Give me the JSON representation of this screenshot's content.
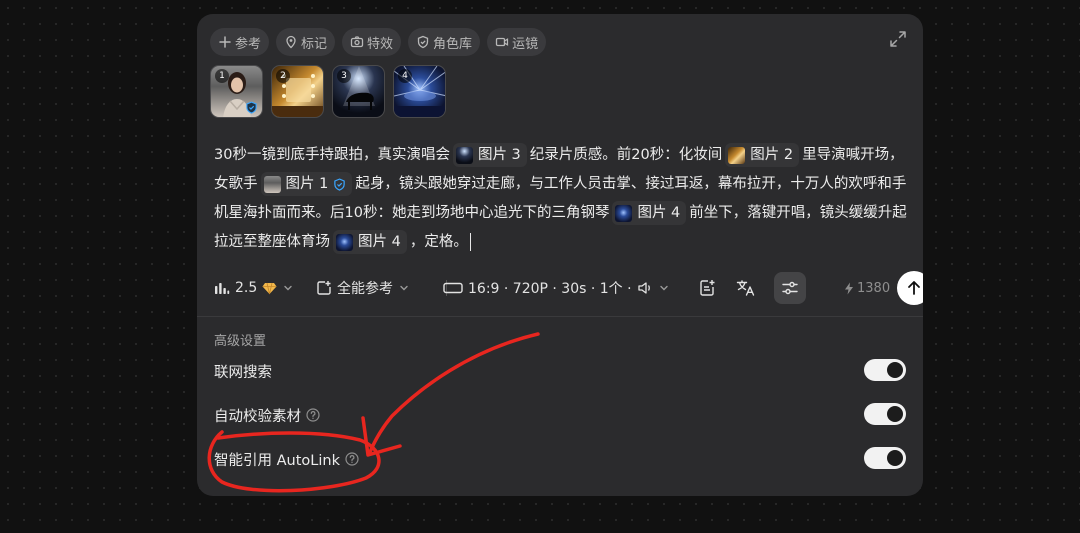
{
  "toolbar_top": {
    "pills": [
      {
        "icon": "plus-icon",
        "label": "参考"
      },
      {
        "icon": "location-pin-icon",
        "label": "标记"
      },
      {
        "icon": "camera-icon",
        "label": "特效"
      },
      {
        "icon": "shield-icon",
        "label": "角色库"
      },
      {
        "icon": "video-camera-icon",
        "label": "运镜"
      }
    ],
    "expand_icon": "expand-icon"
  },
  "thumbnails": [
    {
      "number": "1",
      "verified": true
    },
    {
      "number": "2",
      "verified": false
    },
    {
      "number": "3",
      "verified": false
    },
    {
      "number": "4",
      "verified": false
    }
  ],
  "prompt": {
    "seg1": "30秒一镜到底手持跟拍，真实演唱会",
    "ref3a": "图片 3",
    "seg2": "纪录片质感。前20秒：化妆间",
    "ref2": "图片 2",
    "seg3": "里导演喊开场，女歌手",
    "ref1": "图片 1",
    "seg4": "起身，镜头跟她穿过走廊，与工作人员击掌、接过耳返，幕布拉开，十万人的欢呼和手机星海扑面而来。后10秒：她走到场地中心追光下的三角钢琴",
    "ref4a": "图片 4",
    "seg5": "前坐下，落键开唱，镜头缓缓升起拉远至整座体育场",
    "ref4b": "图片 4",
    "seg6": "，定格。"
  },
  "controls": {
    "model_version": "2.5",
    "reference_mode": "全能参考",
    "output_settings": "16:9 · 720P · 30s · 1个 ·",
    "credits": "1380"
  },
  "advanced": {
    "title": "高级设置",
    "options": [
      {
        "label": "联网搜索",
        "help": false,
        "enabled": true
      },
      {
        "label": "自动校验素材",
        "help": true,
        "enabled": true
      },
      {
        "label": "智能引用 AutoLink",
        "help": true,
        "enabled": true
      }
    ]
  },
  "colors": {
    "background": "#111111",
    "panel": "#2b2b2d",
    "pill": "#3a3a3d",
    "verify_blue": "#3aa6ff",
    "annotation_red": "#e8261f",
    "toggle_on": "#f2f2f2"
  }
}
